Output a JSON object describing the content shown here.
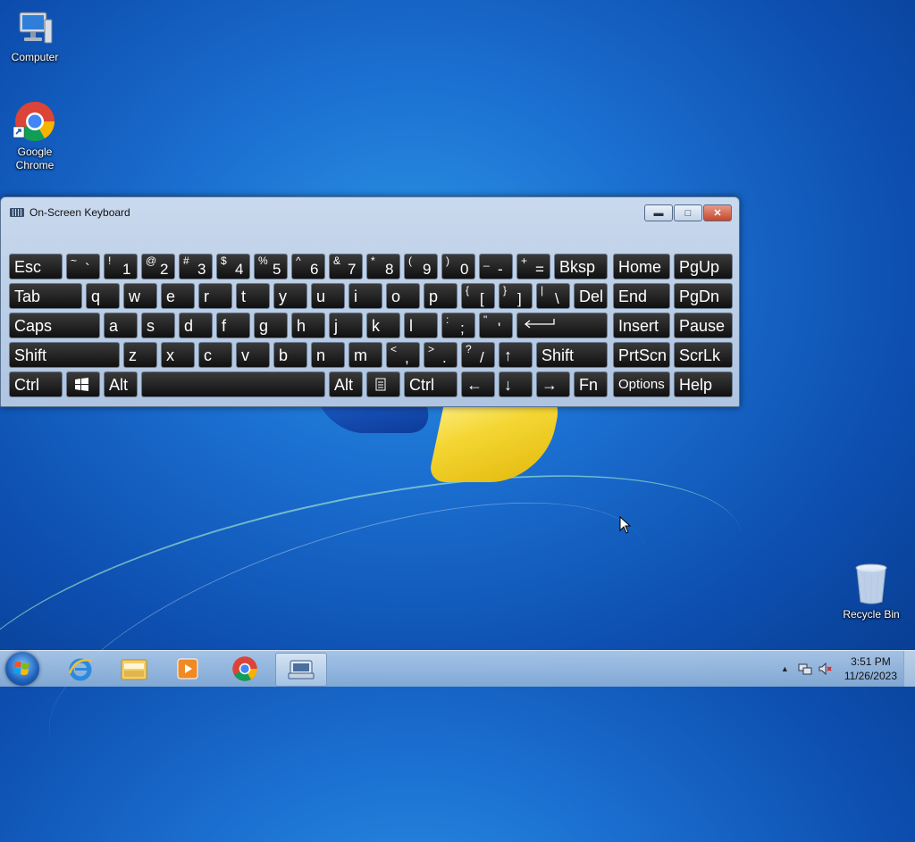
{
  "desktop": {
    "icons": [
      {
        "label": "Computer",
        "icon": "computer-icon"
      },
      {
        "label_line1": "Google",
        "label_line2": "Chrome",
        "icon": "chrome-icon"
      },
      {
        "label": "Recycle Bin",
        "icon": "recycle-bin-icon"
      }
    ]
  },
  "osk": {
    "title": "On-Screen Keyboard",
    "rows": [
      [
        [
          "Esc"
        ],
        [
          "~",
          "`"
        ],
        [
          "!",
          "1"
        ],
        [
          "@",
          "2"
        ],
        [
          "#",
          "3"
        ],
        [
          "$",
          "4"
        ],
        [
          "%",
          "5"
        ],
        [
          "^",
          "6"
        ],
        [
          "&",
          "7"
        ],
        [
          "*",
          "8"
        ],
        [
          "(",
          "9"
        ],
        [
          ")",
          "0"
        ],
        [
          "_",
          "-"
        ],
        [
          "+",
          "="
        ],
        [
          "Bksp"
        ],
        [
          "Home"
        ],
        [
          "PgUp"
        ]
      ],
      [
        [
          "Tab"
        ],
        [
          "q"
        ],
        [
          "w"
        ],
        [
          "e"
        ],
        [
          "r"
        ],
        [
          "t"
        ],
        [
          "y"
        ],
        [
          "u"
        ],
        [
          "i"
        ],
        [
          "o"
        ],
        [
          "p"
        ],
        [
          "{",
          "["
        ],
        [
          "}",
          "]"
        ],
        [
          "|",
          "\\"
        ],
        [
          "Del"
        ],
        [
          "End"
        ],
        [
          "PgDn"
        ]
      ],
      [
        [
          "Caps"
        ],
        [
          "a"
        ],
        [
          "s"
        ],
        [
          "d"
        ],
        [
          "f"
        ],
        [
          "g"
        ],
        [
          "h"
        ],
        [
          "j"
        ],
        [
          "k"
        ],
        [
          "l"
        ],
        [
          ":",
          ";"
        ],
        [
          "\"",
          "'"
        ],
        [
          "enter-arrow"
        ],
        [
          "Insert"
        ],
        [
          "Pause"
        ]
      ],
      [
        [
          "Shift"
        ],
        [
          "z"
        ],
        [
          "x"
        ],
        [
          "c"
        ],
        [
          "v"
        ],
        [
          "b"
        ],
        [
          "n"
        ],
        [
          "m"
        ],
        [
          "<",
          ","
        ],
        [
          ">",
          "."
        ],
        [
          "?",
          "/"
        ],
        [
          "↑"
        ],
        [
          "Shift"
        ],
        [
          "PrtScn"
        ],
        [
          "ScrLk"
        ]
      ],
      [
        [
          "Ctrl"
        ],
        [
          "win"
        ],
        [
          "Alt"
        ],
        [
          ""
        ],
        [
          "Alt"
        ],
        [
          "menu"
        ],
        [
          "Ctrl"
        ],
        [
          "←"
        ],
        [
          "↓"
        ],
        [
          "→"
        ],
        [
          "Fn"
        ],
        [
          "Options"
        ],
        [
          "Help"
        ]
      ]
    ]
  },
  "taskbar": {
    "time": "3:51 PM",
    "date": "11/26/2023",
    "pinned": [
      "internet-explorer-icon",
      "file-explorer-icon",
      "media-player-icon",
      "chrome-icon",
      "on-screen-keyboard-icon"
    ]
  },
  "colors": {
    "desktop": "#1b6fd0",
    "key": "#1a1a1a",
    "window": "#c9d9ee"
  }
}
